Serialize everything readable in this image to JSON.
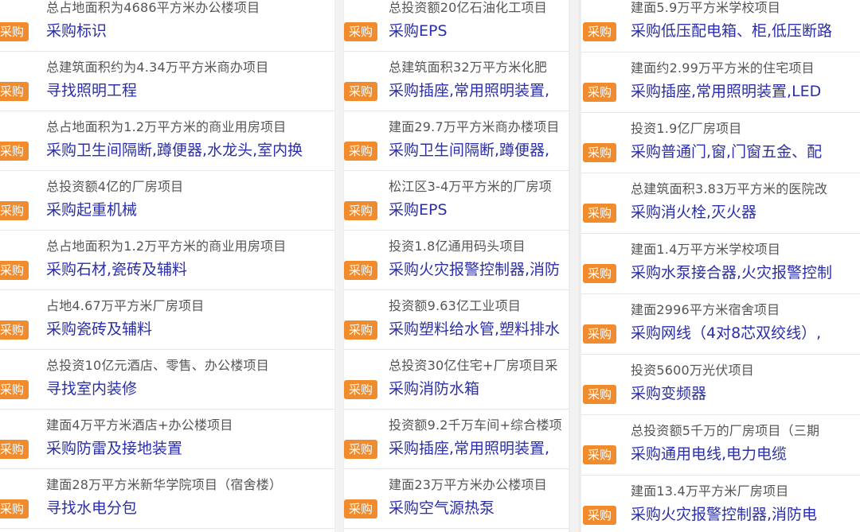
{
  "badge_label": "采购",
  "colors": {
    "badge": "#f08c2e",
    "title": "#2b2fa8",
    "subtitle": "#555555"
  },
  "columns": [
    {
      "items": [
        {
          "project": "总占地面积为4686平方米办公楼项目",
          "title": "采购标识"
        },
        {
          "project": "总建筑面积约为4.34万平方米商办项目",
          "title": "寻找照明工程"
        },
        {
          "project": "总占地面积为1.2万平方米的商业用房项目",
          "title": "采购卫生间隔断,蹲便器,水龙头,室内换"
        },
        {
          "project": "总投资额4亿的厂房项目",
          "title": "采购起重机械"
        },
        {
          "project": "总占地面积为1.2万平方米的商业用房项目",
          "title": "采购石材,瓷砖及辅料"
        },
        {
          "project": "占地4.67万平方米厂房项目",
          "title": "采购瓷砖及辅料"
        },
        {
          "project": "总投资10亿元酒店、零售、办公楼项目",
          "title": "寻找室内装修"
        },
        {
          "project": "建面4万平方米酒店+办公楼项目",
          "title": "采购防雷及接地装置"
        },
        {
          "project": "建面28万平方米新华学院项目（宿舍楼）",
          "title": "寻找水电分包"
        }
      ]
    },
    {
      "items": [
        {
          "project": "总投资额20亿石油化工项目",
          "title": "采购EPS"
        },
        {
          "project": "总建筑面积32万平方米化肥",
          "title": "采购插座,常用照明装置,"
        },
        {
          "project": "建面29.7万平方米商办楼项目",
          "title": "采购卫生间隔断,蹲便器,"
        },
        {
          "project": "松江区3-4万平方米的厂房项",
          "title": "采购EPS"
        },
        {
          "project": "投资1.8亿通用码头项目",
          "title": "采购火灾报警控制器,消防"
        },
        {
          "project": "投资额9.63亿工业项目",
          "title": "采购塑料给水管,塑料排水"
        },
        {
          "project": "总投资30亿住宅+厂房项目采",
          "title": "采购消防水箱"
        },
        {
          "project": "投资额9.2千万车间+综合楼项",
          "title": "采购插座,常用照明装置,"
        },
        {
          "project": "建面23万平方米办公楼项目",
          "title": "采购空气源热泵"
        }
      ]
    },
    {
      "items": [
        {
          "project": "建面5.9万平方米学校项目",
          "title": "采购低压配电箱、柜,低压断路"
        },
        {
          "project": "建面约2.99万平方米的住宅项目",
          "title": "采购插座,常用照明装置,LED"
        },
        {
          "project": "投资1.9亿厂房项目",
          "title": "采购普通门,窗,门窗五金、配"
        },
        {
          "project": "总建筑面积3.83万平方米的医院改",
          "title": "采购消火栓,灭火器"
        },
        {
          "project": "建面1.4万平方米学校项目",
          "title": "采购水泵接合器,火灾报警控制"
        },
        {
          "project": "建面2996平方米宿舍项目",
          "title": "采购网线（4对8芯双绞线）,"
        },
        {
          "project": "投资5600万光伏项目",
          "title": "采购变频器"
        },
        {
          "project": "总投资额5千万的厂房项目（三期",
          "title": "采购通用电线,电力电缆"
        },
        {
          "project": "建面13.4万平方米厂房项目",
          "title": "采购火灾报警控制器,消防电"
        }
      ]
    }
  ]
}
